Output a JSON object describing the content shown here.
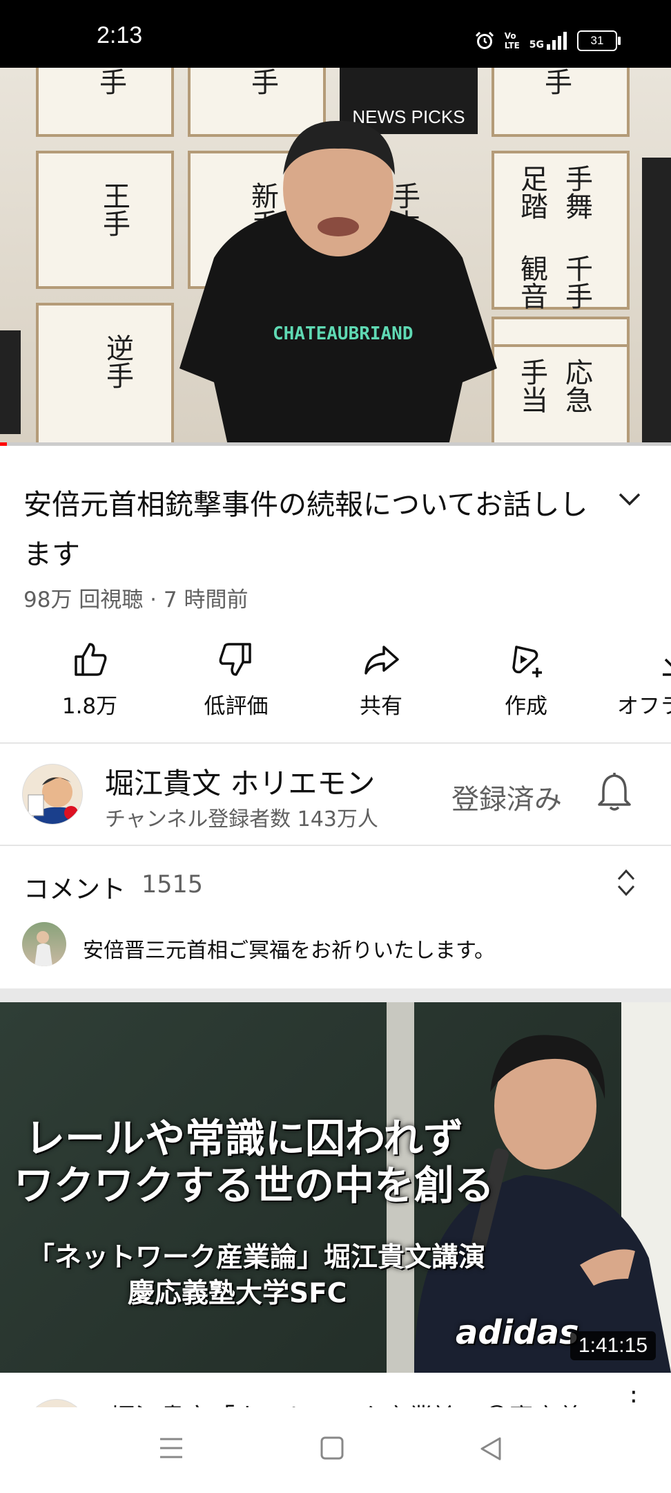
{
  "status": {
    "time": "2:13",
    "network": "5G",
    "volte": "Vo\nLTE",
    "battery": "31"
  },
  "video": {
    "title": "安倍元首相銃撃事件の続報についてお話しします",
    "meta": "98万 回視聴 · 7 時間前",
    "progress_fraction": 0.01,
    "shirt_text": "CHATEAUBRIAND",
    "sign_text": "NEWS PICKS",
    "kanji": [
      "手",
      "手",
      "手",
      "王手",
      "新手",
      "手本",
      "足踏",
      "手舞",
      "観音",
      "千手",
      "逆手",
      "手当",
      "応急"
    ]
  },
  "actions": [
    {
      "label": "1.8万",
      "icon": "like-icon"
    },
    {
      "label": "低評価",
      "icon": "dislike-icon"
    },
    {
      "label": "共有",
      "icon": "share-icon"
    },
    {
      "label": "作成",
      "icon": "create-icon"
    },
    {
      "label": "オフラ",
      "icon": "download-icon"
    }
  ],
  "channel": {
    "name": "堀江貴文 ホリエモン",
    "subscribers": "チャンネル登録者数 143万人",
    "subscribed_label": "登録済み"
  },
  "comments": {
    "label": "コメント",
    "count": "1515",
    "top_comment": "安倍晋三元首相ご冥福をお祈りいたします。"
  },
  "next_video": {
    "thumb_line1": "レールや常識に囚われず",
    "thumb_line2": "ワクワクする世の中を創る",
    "thumb_line3": "「ネットワーク産業論」堀江貴文講演",
    "thumb_line4": "慶応義塾大学SFC",
    "shirt_text": "adidas",
    "duration": "1:41:15",
    "title": "堀江貴文「ネットワーク産業論」＠慶応義"
  },
  "colors": {
    "accent": "#ff0000",
    "secondary_text": "#606060",
    "status_bar": "#000000"
  }
}
